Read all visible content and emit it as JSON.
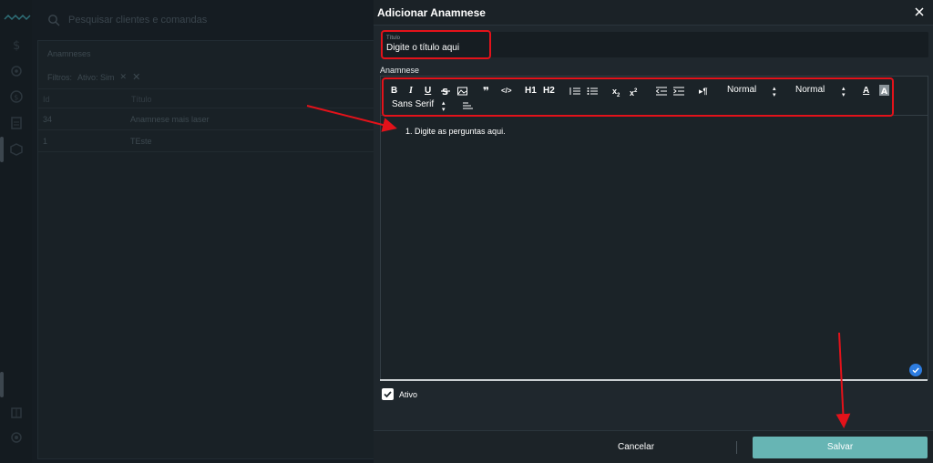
{
  "background": {
    "search_placeholder": "Pesquisar clientes e comandas",
    "panel_title": "Anamneses",
    "filters_label": "Filtros:",
    "filter_chip": "Ativo: Sim",
    "columns": [
      "Id",
      "Título"
    ],
    "rows": [
      {
        "id": "34",
        "title": "Anamnese mais laser"
      },
      {
        "id": "1",
        "title": "TEste"
      }
    ]
  },
  "modal": {
    "title": "Adicionar Anamnese",
    "title_field_label": "Título",
    "title_field_placeholder": "Digite o título aqui",
    "editor_label": "Anamnese",
    "toolbar": {
      "bold": "B",
      "italic": "I",
      "underline": "U",
      "header1": "H1",
      "header2": "H2",
      "size_select": "Normal",
      "header_select": "Normal",
      "font_select": "Sans Serif"
    },
    "editor_content": "1. Digite as perguntas aqui.",
    "active_label": "Ativo",
    "active_checked": true,
    "cancel_label": "Cancelar",
    "save_label": "Salvar"
  },
  "colors": {
    "accent": "#67b5b4",
    "highlight": "#e3121a",
    "modal_bg": "#1f272d"
  }
}
